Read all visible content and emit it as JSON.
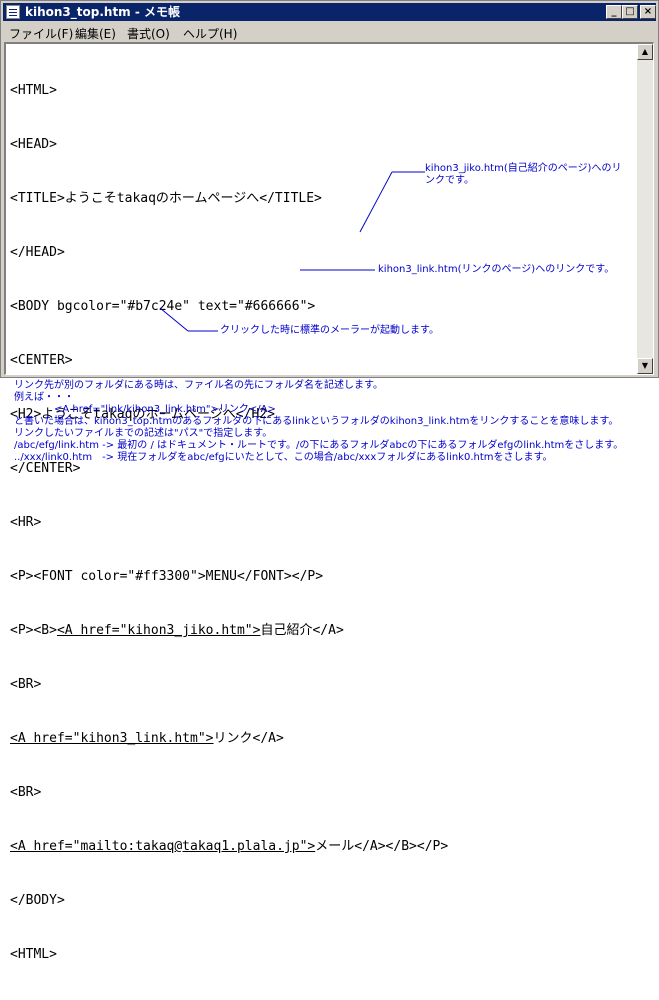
{
  "window": {
    "title": "kihon3_top.htm - メモ帳",
    "buttons": {
      "minimize": "_",
      "maximize": "□",
      "close": "×"
    }
  },
  "menu": {
    "items": [
      "ファイル(F)",
      "編集(E)",
      "書式(O)",
      "ヘルプ(H)"
    ]
  },
  "code": {
    "lines": [
      "<HTML>",
      "<HEAD>",
      "<TITLE>ようこそtakaqのホームページへ</TITLE>",
      "</HEAD>",
      "<BODY bgcolor=\"#b7c24e\" text=\"#666666\">",
      "<CENTER>",
      "<H2>ようこそtakaqのホームページへ</H2>",
      "</CENTER>",
      "<HR>",
      "<P><FONT color=\"#ff3300\">MENU</FONT></P>",
      "<P><B><A href=\"kihon3_jiko.htm\">自己紹介</A>",
      "<BR>",
      "<A href=\"kihon3_link.htm\">リンク</A>",
      "<BR>",
      "<A href=\"mailto:takaq@takaq1.plala.jp\">メール</A></B></P>",
      "</BODY>",
      "<HTML>"
    ],
    "underlined": {
      "jiko": "<A href=\"kihon3_jiko.htm\">",
      "link": "<A href=\"kihon3_link.htm\">",
      "mail": "<A href=\"mailto:takaq@takaq1.plala.jp\">"
    }
  },
  "annotations": {
    "jiko": "kihon3_jiko.htm(自己紹介のページ)へのリンクです。",
    "link": "kihon3_link.htm(リンクのページ)へのリンクです。",
    "mail": "クリックした時に標準のメーラーが起動します。"
  },
  "notes": [
    "リンク先が別のフォルダにある時は、ファイル名の先にフォルダ名を記述します。",
    "例えば・・・",
    "",
    "　　　　<A href=\"link/kihon3_link.htm\">リンク</A>",
    "",
    "と書いた場合は、kihon3_top.htmのあるフォルダの下にあるlinkというフォルダのkihon3_link.htmをリンクすることを意味します。",
    "リンクしたいファイルまでの記述は\"パス\"で指定します。",
    "",
    "/abc/efg/link.htm -> 最初の / はドキュメント・ルートです。/の下にあるフォルダabcの下にあるフォルダefgのlink.htmをさします。",
    "../xxx/link0.htm　-> 現在フォルダをabc/efgにいたとして、この場合/abc/xxxフォルダにあるlink0.htmをさします。"
  ],
  "colors": {
    "titlebar": "#0a246a",
    "annotation": "#0000cc"
  }
}
